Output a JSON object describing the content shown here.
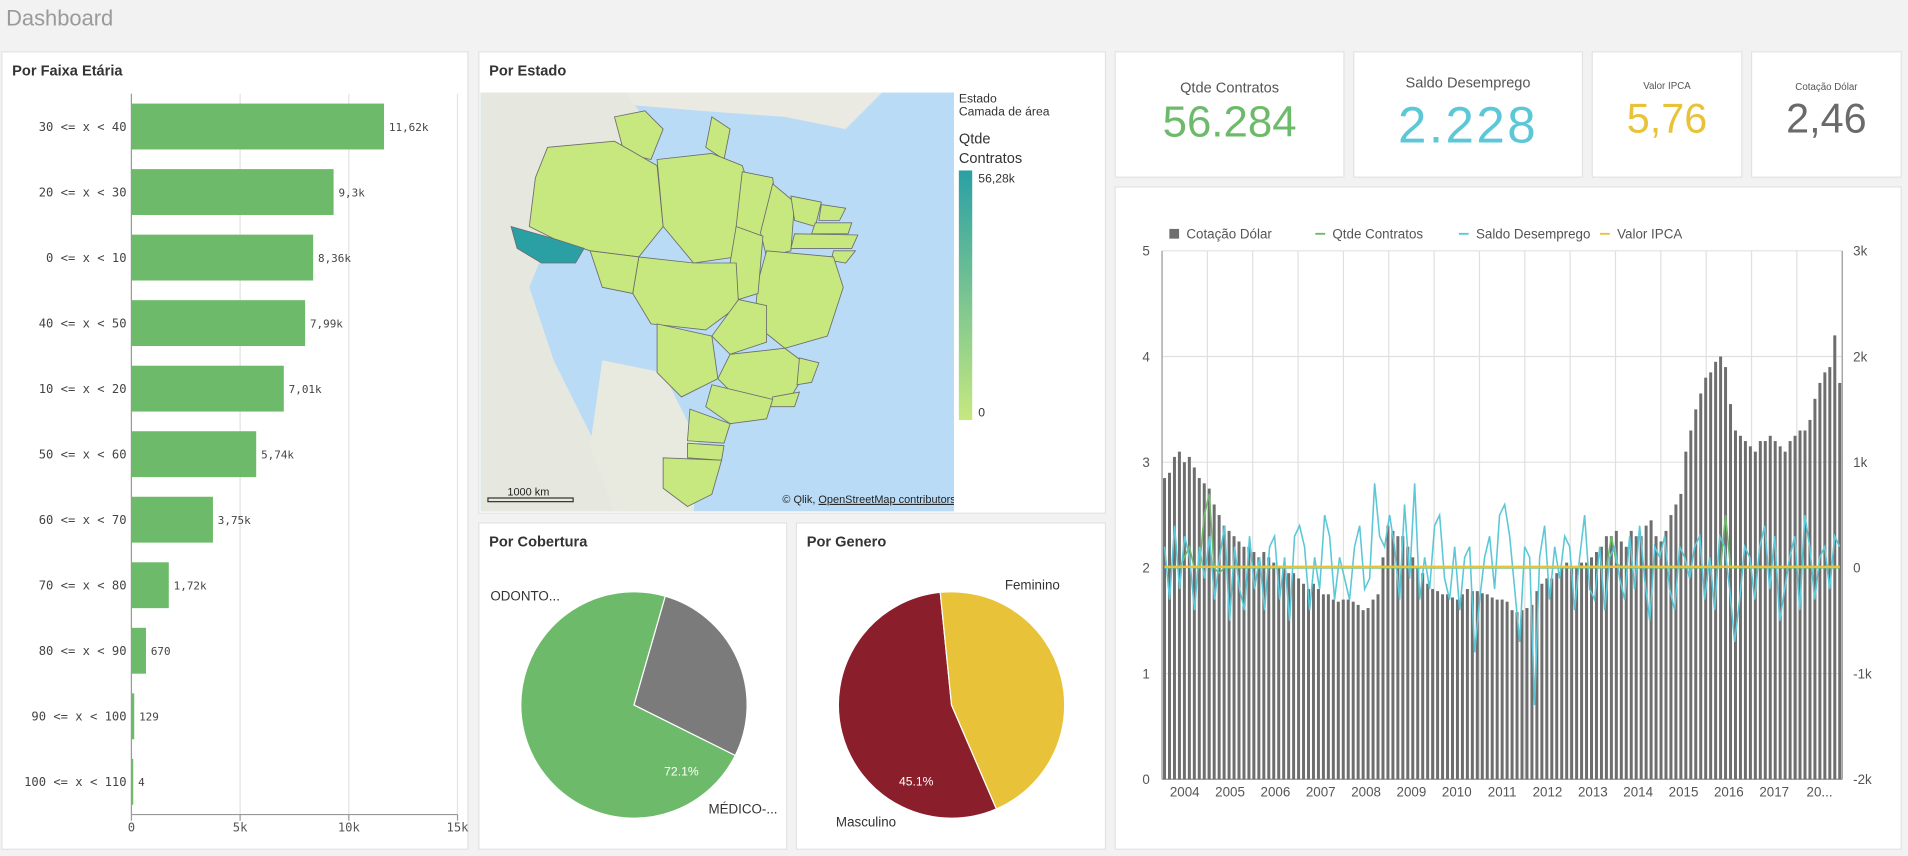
{
  "header": {
    "title": "Dashboard"
  },
  "age_panel": {
    "title": "Por Faixa Etária"
  },
  "map_panel": {
    "title": "Por Estado",
    "legend_line1": "Estado",
    "legend_line2": "Camada de área",
    "legend_measure_1": "Qtde",
    "legend_measure_2": "Contratos",
    "legend_max": "56,28k",
    "legend_min": "0",
    "scale_label": "1000 km",
    "attribution_prefix": "© Qlik, ",
    "attribution_link": "OpenStreetMap contributors",
    "colors": {
      "low": "#c6e87f",
      "high": "#2aa0a4",
      "water": "#b9dbf5",
      "land": "#ececE4"
    }
  },
  "kpis": [
    {
      "label": "Qtde Contratos",
      "value": "56.284",
      "color": "#6dbb6a"
    },
    {
      "label": "Saldo Desemprego",
      "value": "2.228",
      "color": "#5cc8d7"
    },
    {
      "label": "Valor IPCA",
      "value": "5,76",
      "color": "#e8c33a"
    },
    {
      "label": "Cotação Dólar",
      "value": "2,46",
      "color": "#6a6a6a"
    }
  ],
  "coverage_panel": {
    "title": "Por Cobertura"
  },
  "gender_panel": {
    "title": "Por Genero"
  },
  "combo_panel": {
    "legend": [
      "Cotação Dólar",
      "Qtde Contratos",
      "Saldo Desemprego",
      "Valor IPCA"
    ]
  },
  "chart_data": [
    {
      "id": "faixa-etaria",
      "type": "bar",
      "orientation": "horizontal",
      "title": "Por Faixa Etária",
      "categories": [
        "30 <= x < 40",
        "20 <= x < 30",
        "0 <= x < 10",
        "40 <= x < 50",
        "10 <= x < 20",
        "50 <= x < 60",
        "60 <= x < 70",
        "70 <= x < 80",
        "80 <= x < 90",
        "90 <= x < 100",
        "100 <= x < 110"
      ],
      "values": [
        11620,
        9300,
        8360,
        7990,
        7010,
        5740,
        3750,
        1720,
        670,
        129,
        4
      ],
      "value_labels": [
        "11,62k",
        "9,3k",
        "8,36k",
        "7,99k",
        "7,01k",
        "5,74k",
        "3,75k",
        "1,72k",
        "670",
        "129",
        "4"
      ],
      "xlim": [
        0,
        15000
      ],
      "ticks": [
        0,
        5000,
        10000,
        15000
      ],
      "tick_labels": [
        "0",
        "5k",
        "10k",
        "15k"
      ],
      "color": "#6dbb6a",
      "grid": true
    },
    {
      "id": "cobertura",
      "type": "pie",
      "title": "Por Cobertura",
      "slices": [
        {
          "label": "ODONTO...",
          "value": 27.9,
          "value_label": "27.9%",
          "color": "#7b7b7b"
        },
        {
          "label": "MÉDICO-...",
          "value": 72.1,
          "value_label": "72.1%",
          "color": "#6dbb6a"
        }
      ]
    },
    {
      "id": "genero",
      "type": "pie",
      "title": "Por Genero",
      "slices": [
        {
          "label": "Feminino",
          "value": 54.9,
          "value_label": "54.9%",
          "color": "#8b1e2b"
        },
        {
          "label": "Masculino",
          "value": 45.1,
          "value_label": "45.1%",
          "color": "#e8c33a"
        }
      ]
    },
    {
      "id": "series-temporal",
      "type": "bar",
      "title": "",
      "x_tick_labels": [
        "2004",
        "2005",
        "2006",
        "2007",
        "2008",
        "2009",
        "2010",
        "2011",
        "2012",
        "2013",
        "2014",
        "2015",
        "2016",
        "2017",
        "20..."
      ],
      "left_axis": {
        "ticks": [
          0,
          1,
          2,
          3,
          4,
          5
        ],
        "ylim": [
          0,
          5
        ]
      },
      "right_axis": {
        "ticks": [
          "-2k",
          "-1k",
          "0",
          "1k",
          "2k",
          "3k"
        ],
        "ylim": [
          -2000,
          3000
        ]
      },
      "grid": true,
      "series": [
        {
          "name": "Cotação Dólar",
          "type": "bar",
          "axis": "left",
          "color": "#6e6e6e",
          "values": [
            2.85,
            2.9,
            3.05,
            3.1,
            3.0,
            3.05,
            2.95,
            2.85,
            2.8,
            2.75,
            2.6,
            2.5,
            2.4,
            2.35,
            2.3,
            2.25,
            2.2,
            2.2,
            2.15,
            2.1,
            2.15,
            2.1,
            2.05,
            2.0,
            2.0,
            1.95,
            1.95,
            1.9,
            1.85,
            1.8,
            1.85,
            1.8,
            1.75,
            1.75,
            1.7,
            1.68,
            1.7,
            1.7,
            1.68,
            1.65,
            1.6,
            1.62,
            1.7,
            1.75,
            2.1,
            2.4,
            2.35,
            2.3,
            2.3,
            2.2,
            2.1,
            2.0,
            1.95,
            1.85,
            1.8,
            1.78,
            1.75,
            1.75,
            1.72,
            1.7,
            1.75,
            1.8,
            1.78,
            1.78,
            1.76,
            1.75,
            1.72,
            1.7,
            1.7,
            1.68,
            1.6,
            1.58,
            1.6,
            1.62,
            1.65,
            1.78,
            1.85,
            1.9,
            1.9,
            1.95,
            2.0,
            2.05,
            2.0,
            2.0,
            2.05,
            2.05,
            2.1,
            2.15,
            2.2,
            2.3,
            2.3,
            2.35,
            2.25,
            2.2,
            2.35,
            2.3,
            2.3,
            2.4,
            2.45,
            2.3,
            2.25,
            2.35,
            2.5,
            2.6,
            2.7,
            3.1,
            3.3,
            3.5,
            3.65,
            3.8,
            3.85,
            3.95,
            4.0,
            3.9,
            3.55,
            3.3,
            3.25,
            3.2,
            3.15,
            3.1,
            3.2,
            3.2,
            3.25,
            3.2,
            3.15,
            3.1,
            3.2,
            3.25,
            3.3,
            3.3,
            3.4,
            3.6,
            3.75,
            3.85,
            3.9,
            4.2,
            3.75
          ]
        },
        {
          "name": "Qtde Contratos",
          "type": "line",
          "axis": "right",
          "color": "#6dbb6a",
          "values": [
            0,
            0,
            0,
            0,
            100,
            200,
            0,
            0,
            500,
            700,
            0,
            -50,
            0,
            0,
            0,
            0,
            0,
            0,
            0,
            0,
            0,
            0,
            0,
            0,
            0,
            0,
            0,
            0,
            0,
            0,
            0,
            0,
            0,
            0,
            0,
            0,
            0,
            0,
            0,
            0,
            0,
            0,
            0,
            0,
            0,
            0,
            0,
            0,
            0,
            0,
            0,
            0,
            0,
            0,
            0,
            0,
            0,
            0,
            0,
            0,
            0,
            0,
            0,
            0,
            0,
            0,
            0,
            0,
            0,
            0,
            0,
            0,
            0,
            0,
            0,
            0,
            0,
            0,
            0,
            0,
            0,
            0,
            0,
            0,
            0,
            0,
            0,
            0,
            0,
            0,
            300,
            50,
            0,
            0,
            0,
            0,
            0,
            0,
            0,
            0,
            0,
            0,
            0,
            0,
            0,
            0,
            0,
            0,
            0,
            0,
            0,
            0,
            0,
            500,
            0,
            0,
            0,
            0,
            0,
            0,
            0,
            0,
            0,
            0,
            0,
            0,
            0,
            0,
            0,
            0,
            0,
            0,
            0,
            0,
            0,
            0,
            0
          ]
        },
        {
          "name": "Saldo Desemprego",
          "type": "line",
          "axis": "right",
          "color": "#5cc8d7",
          "values": [
            200,
            -300,
            400,
            -200,
            300,
            100,
            -400,
            200,
            -100,
            300,
            -300,
            100,
            400,
            -500,
            200,
            -200,
            -400,
            300,
            -200,
            100,
            -400,
            200,
            300,
            -300,
            100,
            -500,
            300,
            400,
            200,
            -400,
            100,
            -200,
            500,
            300,
            -300,
            100,
            -100,
            -300,
            200,
            400,
            -200,
            -100,
            800,
            300,
            200,
            500,
            200,
            -300,
            600,
            -100,
            800,
            -300,
            100,
            -200,
            400,
            500,
            -100,
            -300,
            200,
            -400,
            100,
            200,
            -800,
            -300,
            100,
            300,
            -200,
            500,
            600,
            300,
            -200,
            -700,
            200,
            100,
            -1300,
            100,
            400,
            -300,
            200,
            -100,
            300,
            200,
            -400,
            100,
            500,
            -200,
            -300,
            200,
            -400,
            100,
            200,
            -100,
            -300,
            300,
            -200,
            400,
            -100,
            -500,
            200,
            100,
            300,
            -200,
            -400,
            200,
            100,
            -100,
            200,
            300,
            -300,
            100,
            -400,
            300,
            200,
            -200,
            -700,
            -300,
            200,
            100,
            -300,
            200,
            400,
            -200,
            300,
            -500,
            -200,
            100,
            300,
            -400,
            500,
            200,
            -300,
            100,
            200,
            -200,
            300,
            200
          ]
        },
        {
          "name": "Valor IPCA",
          "type": "line",
          "axis": "right",
          "color": "#e8c33a",
          "values": [
            10,
            10,
            10,
            10,
            10,
            10,
            10,
            10,
            10,
            10,
            10,
            10,
            10,
            10,
            10,
            10,
            10,
            10,
            10,
            10,
            10,
            10,
            10,
            10,
            10,
            10,
            10,
            10,
            10,
            10,
            10,
            10,
            10,
            10,
            10,
            10,
            10,
            10,
            10,
            10,
            10,
            10,
            10,
            10,
            10,
            10,
            10,
            10,
            10,
            10,
            10,
            10,
            10,
            10,
            10,
            10,
            10,
            10,
            10,
            10,
            10,
            10,
            10,
            10,
            10,
            10,
            10,
            10,
            10,
            10,
            10,
            10,
            10,
            10,
            10,
            10,
            10,
            10,
            10,
            10,
            10,
            10,
            10,
            10,
            10,
            10,
            10,
            10,
            10,
            10,
            10,
            10,
            10,
            10,
            10,
            10,
            10,
            10,
            10,
            10,
            10,
            10,
            10,
            10,
            10,
            10,
            10,
            10,
            10,
            10,
            10,
            10,
            10,
            10,
            10,
            10,
            10,
            10,
            10,
            10,
            10,
            10,
            10,
            10,
            10,
            10,
            10,
            10,
            10,
            10,
            10,
            10,
            10,
            10,
            10,
            10,
            10
          ]
        }
      ]
    }
  ]
}
